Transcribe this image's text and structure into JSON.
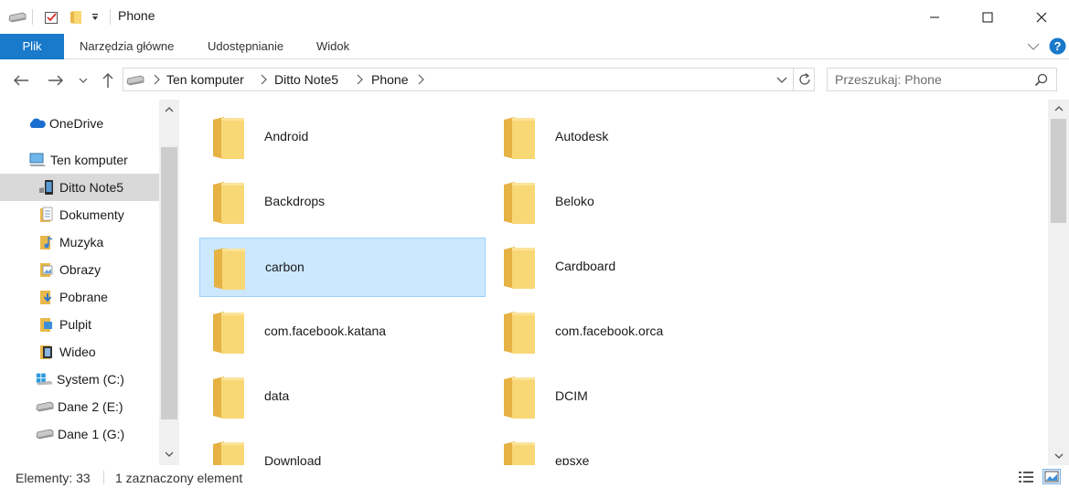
{
  "window": {
    "title": "Phone",
    "minimize_label": "minimize",
    "maximize_label": "maximize",
    "close_label": "close"
  },
  "ribbon": {
    "tabs": [
      "Plik",
      "Narzędzia główne",
      "Udostępnianie",
      "Widok"
    ],
    "accent": "#1979ca"
  },
  "address": {
    "crumbs": [
      "Ten komputer",
      "Ditto Note5",
      "Phone"
    ]
  },
  "search": {
    "placeholder": "Przeszukaj: Phone"
  },
  "nav": {
    "items": [
      {
        "label": "OneDrive",
        "icon": "cloud-icon"
      },
      {
        "label": "Ten komputer",
        "icon": "computer-icon"
      },
      {
        "label": "Ditto Note5",
        "icon": "phone-icon",
        "selected": true
      },
      {
        "label": "Dokumenty",
        "icon": "documents-icon"
      },
      {
        "label": "Muzyka",
        "icon": "music-icon"
      },
      {
        "label": "Obrazy",
        "icon": "pictures-icon"
      },
      {
        "label": "Pobrane",
        "icon": "downloads-icon"
      },
      {
        "label": "Pulpit",
        "icon": "desktop-icon"
      },
      {
        "label": "Wideo",
        "icon": "video-icon"
      },
      {
        "label": "System (C:)",
        "icon": "windows-drive-icon"
      },
      {
        "label": "Dane 2 (E:)",
        "icon": "drive-icon"
      },
      {
        "label": "Dane 1 (G:)",
        "icon": "drive-icon"
      }
    ]
  },
  "folders": [
    {
      "name": "Android"
    },
    {
      "name": "Autodesk"
    },
    {
      "name": "Backdrops"
    },
    {
      "name": "Beloko"
    },
    {
      "name": "carbon",
      "selected": true
    },
    {
      "name": "Cardboard"
    },
    {
      "name": "com.facebook.katana"
    },
    {
      "name": "com.facebook.orca"
    },
    {
      "name": "data"
    },
    {
      "name": "DCIM"
    },
    {
      "name": "Download"
    },
    {
      "name": "epsxe"
    }
  ],
  "status": {
    "count": "Elementy: 33",
    "selection": "1 zaznaczony element"
  }
}
